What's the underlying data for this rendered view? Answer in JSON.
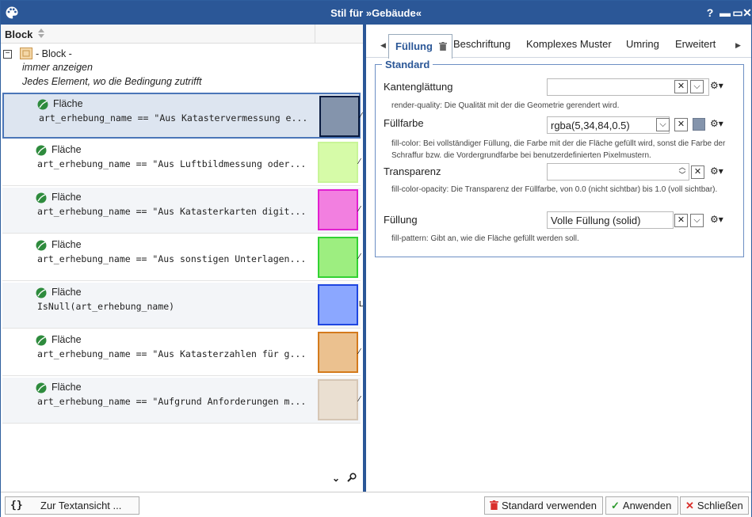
{
  "window": {
    "title": "Stil für »Gebäude«",
    "controls": {
      "help": "?",
      "minimize": "▬",
      "maximize": "▭",
      "close": "✕"
    }
  },
  "left": {
    "header": {
      "column": "Block"
    },
    "block": {
      "title": "- Block -",
      "visibility": "immer anzeigen",
      "condition": "Jedes Element, wo die Bedingung zutrifft"
    },
    "rules": [
      {
        "label": "Fläche",
        "expr": "art_erhebung_name == \"Aus Katastervermessung e...",
        "fill": "#8494ac",
        "stroke": "#0a1b3f",
        "extra": "⁄"
      },
      {
        "label": "Fläche",
        "expr": "art_erhebung_name == \"Aus Luftbildmessung oder...",
        "fill": "#d6fba8",
        "stroke": "#c8f598",
        "extra": "⁄"
      },
      {
        "label": "Fläche",
        "expr": "art_erhebung_name == \"Aus Katasterkarten digit...",
        "fill": "#f27fe0",
        "stroke": "#e21fd0",
        "extra": "⁄"
      },
      {
        "label": "Fläche",
        "expr": "art_erhebung_name == \"Aus sonstigen Unterlagen...",
        "fill": "#9dee80",
        "stroke": "#33d233",
        "extra": "⁄"
      },
      {
        "label": "Fläche",
        "expr": "IsNull(art_erhebung_name)",
        "fill": "#8ba7ff",
        "stroke": "#1f46e0",
        "extra": "L"
      },
      {
        "label": "Fläche",
        "expr": "art_erhebung_name == \"Aus Katasterzahlen für g...",
        "fill": "#ebc18f",
        "stroke": "#d47a1c",
        "extra": "⁄"
      },
      {
        "label": "Fläche",
        "expr": "art_erhebung_name == \"Aufgrund Anforderungen m...",
        "fill": "#eadfd1",
        "stroke": "#d6c6b5",
        "extra": "⁄"
      }
    ],
    "bottom_icons": "⌄ 🔍"
  },
  "right": {
    "tabs": [
      "Füllung",
      "Beschriftung",
      "Komplexes Muster",
      "Umring",
      "Erweitert"
    ],
    "active_tab": 0,
    "group": {
      "title": "Standard",
      "properties": [
        {
          "label": "Kantenglättung",
          "value": "",
          "desc": "render-quality: Die Qualität mit der die Geometrie gerendert wird."
        },
        {
          "label": "Füllfarbe",
          "value": "rgba(5,34,84,0.5)",
          "desc": "fill-color: Bei vollständiger Füllung, die Farbe mit der die Fläche gefüllt wird, sonst die Farbe der Schraffur bzw. die Vordergrundfarbe bei benutzerdefinierten Pixelmustern.",
          "chip": "#8494ac"
        },
        {
          "label": "Transparenz",
          "value": "",
          "desc": "fill-color-opacity: Die Transparenz der Füllfarbe, von 0.0 (nicht sichtbar) bis 1.0 (voll sichtbar)."
        },
        {
          "label": "Füllung",
          "value": "Volle Füllung (solid)",
          "desc": "fill-pattern: Gibt an, wie die Fläche gefüllt werden soll."
        }
      ]
    }
  },
  "buttons": {
    "text_view_icon": "{}",
    "text_view": "Zur Textansicht ...",
    "use_default": "Standard verwenden",
    "apply": "Anwenden",
    "close": "Schließen"
  },
  "colors": {
    "title_bar": "#2b5797",
    "accent": "#2b5797",
    "delete_red": "#d9302c",
    "apply_green": "#2e9a2e"
  }
}
